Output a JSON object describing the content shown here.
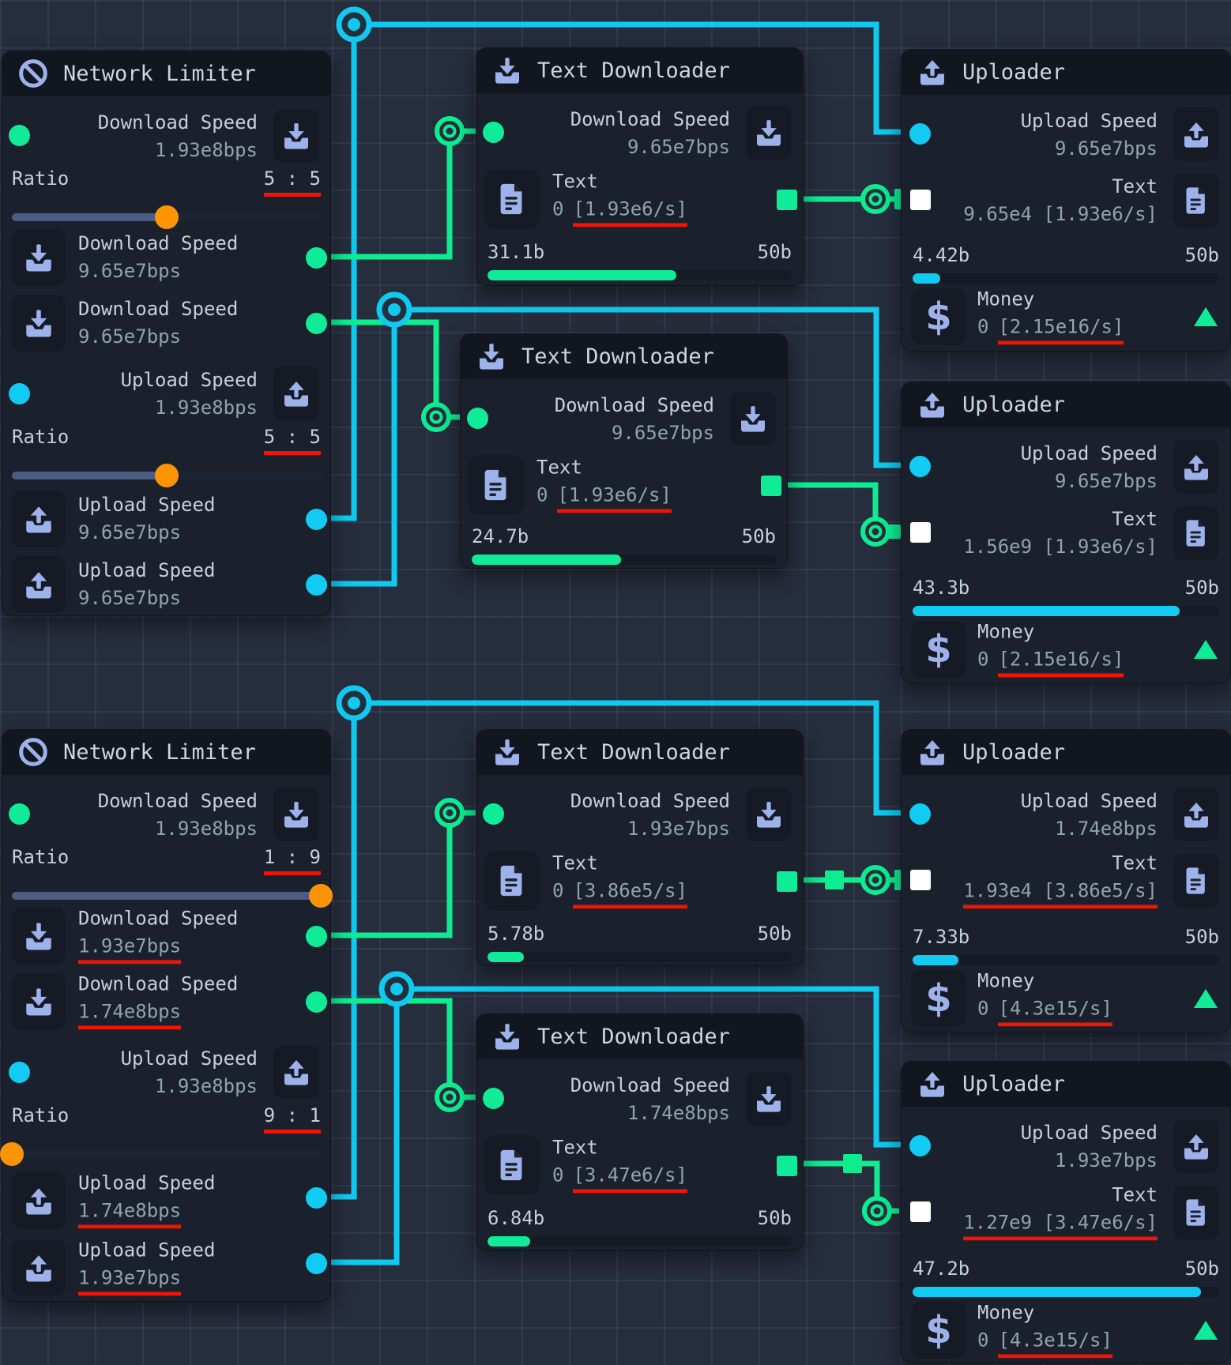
{
  "colors": {
    "green_port": "#10eb97",
    "cyan_port": "#12cbf2",
    "icon_periwinkle": "#9db2ea",
    "slider_knob_orange": "#fc9405",
    "underline_red": "#f01505",
    "wire_green": "#0ded8f",
    "wire_cyan": "#0fc9ef"
  },
  "nodes": {
    "l1": {
      "title": "Network Limiter",
      "dl_in": {
        "label": "Download Speed",
        "value": "1.93e8bps"
      },
      "ratio_dl": {
        "label": "Ratio",
        "value": "5 : 5",
        "pct": 50
      },
      "dl_out1": {
        "label": "Download Speed",
        "value": "9.65e7bps"
      },
      "dl_out2": {
        "label": "Download Speed",
        "value": "9.65e7bps"
      },
      "ul_in": {
        "label": "Upload Speed",
        "value": "1.93e8bps"
      },
      "ratio_ul": {
        "label": "Ratio",
        "value": "5 : 5",
        "pct": 50
      },
      "ul_out1": {
        "label": "Upload Speed",
        "value": "9.65e7bps"
      },
      "ul_out2": {
        "label": "Upload Speed",
        "value": "9.65e7bps"
      }
    },
    "l2": {
      "title": "Network Limiter",
      "dl_in": {
        "label": "Download Speed",
        "value": "1.93e8bps"
      },
      "ratio_dl": {
        "label": "Ratio",
        "value": "1 : 9",
        "pct": 100
      },
      "dl_out1": {
        "label": "Download Speed",
        "value": "1.93e7bps"
      },
      "dl_out2": {
        "label": "Download Speed",
        "value": "1.74e8bps"
      },
      "ul_in": {
        "label": "Upload Speed",
        "value": "1.93e8bps"
      },
      "ratio_ul": {
        "label": "Ratio",
        "value": "9 : 1",
        "pct": 0
      },
      "ul_out1": {
        "label": "Upload Speed",
        "value": "1.74e8bps"
      },
      "ul_out2": {
        "label": "Upload Speed",
        "value": "1.93e7bps"
      }
    },
    "td1": {
      "title": "Text Downloader",
      "dl_in": {
        "label": "Download Speed",
        "value": "9.65e7bps"
      },
      "text": {
        "label": "Text",
        "pre": "0",
        "rate": "[1.93e6/s]"
      },
      "progress": {
        "current": "31.1b",
        "total": "50b",
        "pct": 62
      }
    },
    "td2": {
      "title": "Text Downloader",
      "dl_in": {
        "label": "Download Speed",
        "value": "9.65e7bps"
      },
      "text": {
        "label": "Text",
        "pre": "0",
        "rate": "[1.93e6/s]"
      },
      "progress": {
        "current": "24.7b",
        "total": "50b",
        "pct": 49
      }
    },
    "td3": {
      "title": "Text Downloader",
      "dl_in": {
        "label": "Download Speed",
        "value": "1.93e7bps"
      },
      "text": {
        "label": "Text",
        "pre": "0",
        "rate": "[3.86e5/s]"
      },
      "progress": {
        "current": "5.78b",
        "total": "50b",
        "pct": 12
      }
    },
    "td4": {
      "title": "Text Downloader",
      "dl_in": {
        "label": "Download Speed",
        "value": "1.74e8bps"
      },
      "text": {
        "label": "Text",
        "pre": "0",
        "rate": "[3.47e6/s]"
      },
      "progress": {
        "current": "6.84b",
        "total": "50b",
        "pct": 14
      }
    },
    "u1": {
      "title": "Uploader",
      "ul_in": {
        "label": "Upload Speed",
        "value": "9.65e7bps"
      },
      "text": {
        "label": "Text",
        "value": "9.65e4 [1.93e6/s]"
      },
      "progress": {
        "current": "4.42b",
        "total": "50b",
        "pct": 9
      },
      "money": {
        "label": "Money",
        "pre": "0",
        "rate": "[2.15e16/s]"
      }
    },
    "u2": {
      "title": "Uploader",
      "ul_in": {
        "label": "Upload Speed",
        "value": "9.65e7bps"
      },
      "text": {
        "label": "Text",
        "value": "1.56e9 [1.93e6/s]"
      },
      "progress": {
        "current": "43.3b",
        "total": "50b",
        "pct": 87
      },
      "money": {
        "label": "Money",
        "pre": "0",
        "rate": "[2.15e16/s]"
      }
    },
    "u3": {
      "title": "Uploader",
      "ul_in": {
        "label": "Upload Speed",
        "value": "1.74e8bps"
      },
      "text": {
        "label": "Text",
        "value": "1.93e4 [3.86e5/s]"
      },
      "progress": {
        "current": "7.33b",
        "total": "50b",
        "pct": 15
      },
      "money": {
        "label": "Money",
        "pre": "0",
        "rate": "[4.3e15/s]"
      }
    },
    "u4": {
      "title": "Uploader",
      "ul_in": {
        "label": "Upload Speed",
        "value": "1.93e7bps"
      },
      "text": {
        "label": "Text",
        "value": "1.27e9 [3.47e6/s]"
      },
      "progress": {
        "current": "47.2b",
        "total": "50b",
        "pct": 94
      },
      "money": {
        "label": "Money",
        "pre": "0",
        "rate": "[4.3e15/s]"
      }
    }
  }
}
